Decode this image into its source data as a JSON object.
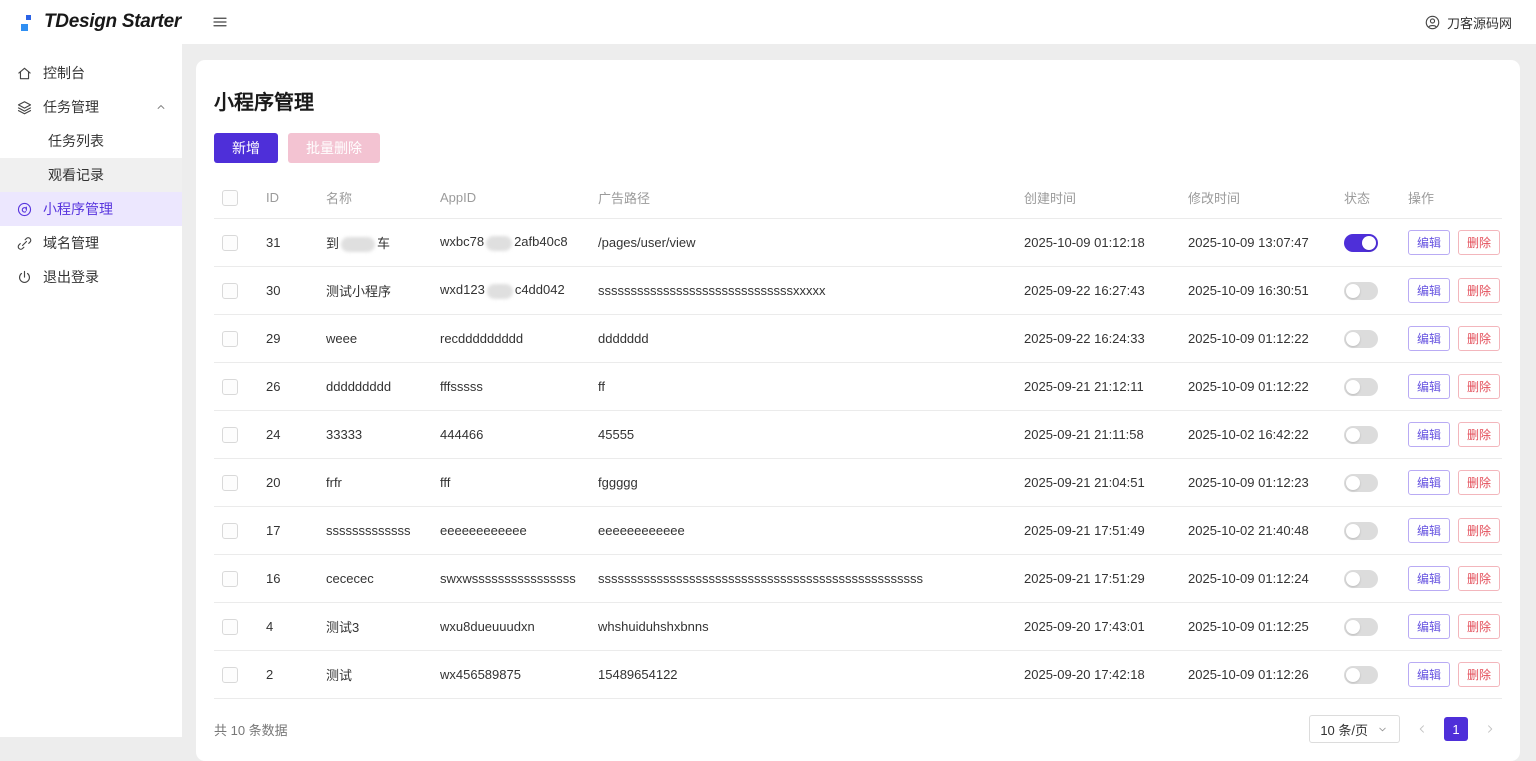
{
  "header": {
    "logo": "TDesign Starter",
    "user": "刀客源码网"
  },
  "sidebar": {
    "items": [
      {
        "id": "console",
        "label": "控制台",
        "icon": "home-icon",
        "level": 1
      },
      {
        "id": "task-management",
        "label": "任务管理",
        "icon": "layers-icon",
        "level": 1,
        "chevron": "up"
      },
      {
        "id": "task-list",
        "label": "任务列表",
        "level": 2
      },
      {
        "id": "watch-records",
        "label": "观看记录",
        "level": 2,
        "state": "hover"
      },
      {
        "id": "miniapp-management",
        "label": "小程序管理",
        "icon": "miniapp-icon",
        "level": 1,
        "state": "active"
      },
      {
        "id": "domain-management",
        "label": "域名管理",
        "icon": "link-icon",
        "level": 1
      },
      {
        "id": "logout",
        "label": "退出登录",
        "icon": "power-icon",
        "level": 1
      }
    ]
  },
  "page": {
    "title": "小程序管理",
    "toolbar": {
      "add": "新增",
      "batch_delete": "批量删除"
    },
    "table": {
      "columns": [
        "ID",
        "名称",
        "AppID",
        "广告路径",
        "创建时间",
        "修改时间",
        "状态",
        "操作"
      ],
      "actions": {
        "edit": "编辑",
        "delete": "删除"
      },
      "rows": [
        {
          "id": "31",
          "name": {
            "pre": "到",
            "censored": true,
            "post": "车"
          },
          "appid": {
            "pre": "wxbc78",
            "censored": true,
            "post": "2afb40c8"
          },
          "path": "/pages/user/view",
          "created": "2025-10-09 01:12:18",
          "modified": "2025-10-09 13:07:47",
          "status": "on"
        },
        {
          "id": "30",
          "name": "测试小程序",
          "appid": {
            "pre": "wxd123",
            "censored": true,
            "post": "c4dd042"
          },
          "path": "ssssssssssssssssssssssssssssssxxxxx",
          "created": "2025-09-22 16:27:43",
          "modified": "2025-10-09 16:30:51",
          "status": "off"
        },
        {
          "id": "29",
          "name": "weee",
          "appid": "recddddddddd",
          "path": "ddddddd",
          "created": "2025-09-22 16:24:33",
          "modified": "2025-10-09 01:12:22",
          "status": "off"
        },
        {
          "id": "26",
          "name": "ddddddddd",
          "appid": "fffsssss",
          "path": "ff",
          "created": "2025-09-21 21:12:11",
          "modified": "2025-10-09 01:12:22",
          "status": "off"
        },
        {
          "id": "24",
          "name": "33333",
          "appid": "444466",
          "path": "45555",
          "created": "2025-09-21 21:11:58",
          "modified": "2025-10-02 16:42:22",
          "status": "off"
        },
        {
          "id": "20",
          "name": "frfr",
          "appid": "fff",
          "path": "fggggg",
          "created": "2025-09-21 21:04:51",
          "modified": "2025-10-09 01:12:23",
          "status": "off"
        },
        {
          "id": "17",
          "name": "sssssssssssss",
          "appid": "eeeeeeeeeeee",
          "path": "eeeeeeeeeeee",
          "created": "2025-09-21 17:51:49",
          "modified": "2025-10-02 21:40:48",
          "status": "off"
        },
        {
          "id": "16",
          "name": "cececec",
          "appid": "swxwssssssssssssssss",
          "path": "ssssssssssssssssssssssssssssssssssssssssssssssssss",
          "created": "2025-09-21 17:51:29",
          "modified": "2025-10-09 01:12:24",
          "status": "off"
        },
        {
          "id": "4",
          "name": "测试3",
          "appid": "wxu8dueuuudxn",
          "path": "whshuiduhshxbnns",
          "created": "2025-09-20 17:43:01",
          "modified": "2025-10-09 01:12:25",
          "status": "off"
        },
        {
          "id": "2",
          "name": "测试",
          "appid": "wx456589875",
          "path": "15489654122",
          "created": "2025-09-20 17:42:18",
          "modified": "2025-10-09 01:12:26",
          "status": "off"
        }
      ]
    },
    "pagination": {
      "total": "共 10 条数据",
      "page_size": "10 条/页",
      "current": "1"
    }
  },
  "colors": {
    "brand": "#4e2fd9",
    "brand_active_bg": "#ece7fe",
    "brand_active_text": "#5835de",
    "danger": "#e34d59",
    "batch_delete_disabled_bg": "#f3c3d2",
    "toggle_off": "#dcdcdc",
    "logo_blue_dark": "#2b63e6",
    "logo_blue_light": "#2f8ff2"
  }
}
